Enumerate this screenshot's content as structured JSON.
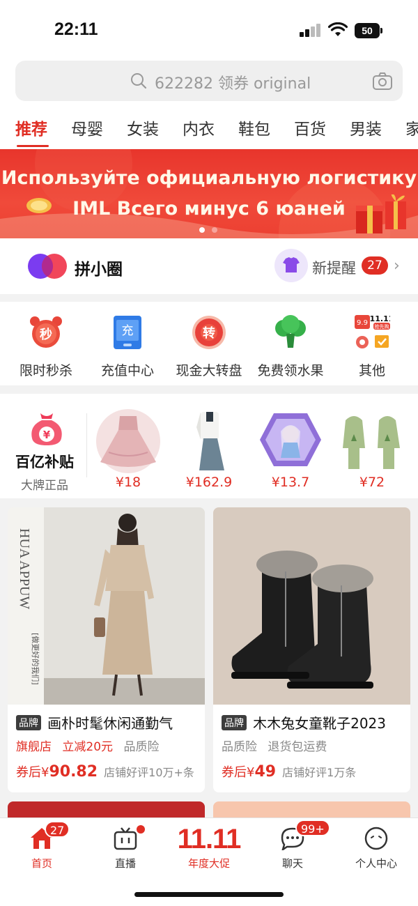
{
  "status_bar": {
    "time": "22:11",
    "battery": "50"
  },
  "search": {
    "placeholder": "622282 领券 original"
  },
  "categories": [
    "推荐",
    "母婴",
    "女装",
    "内衣",
    "鞋包",
    "百货",
    "男装",
    "家"
  ],
  "active_category": "推荐",
  "banner": {
    "line1": "Используйте официальную логистику",
    "line2": "IML Всего минус 6 юаней",
    "page_count": 2,
    "active_page": 1
  },
  "pinxiaoquan": {
    "title": "拼小圈",
    "reminder_label": "新提醒",
    "reminder_count": "27"
  },
  "quick_links": [
    {
      "label": "限时秒杀",
      "icon": "alarm-clock-icon",
      "glyph": "秒"
    },
    {
      "label": "充值中心",
      "icon": "phone-recharge-icon",
      "glyph": "充"
    },
    {
      "label": "现金大转盘",
      "icon": "spin-wheel-icon",
      "glyph": "转"
    },
    {
      "label": "免费领水果",
      "icon": "broccoli-icon",
      "glyph": ""
    },
    {
      "label": "其他",
      "icon": "more-apps-icon",
      "glyph": ""
    }
  ],
  "more_apps_icon_text": {
    "tag_99": "9.9",
    "tag_1111": "11.11",
    "tag_sub": "抢先购"
  },
  "subsidy": {
    "title": "百亿补贴",
    "subtitle": "大牌正品",
    "icon_glyph": "¥",
    "products": [
      {
        "price": "¥18",
        "icon": "pink-dress-image"
      },
      {
        "price": "¥162.9",
        "icon": "blazer-skirt-image"
      },
      {
        "price": "¥13.7",
        "icon": "frozen-toy-box-image"
      },
      {
        "price": "¥72",
        "icon": "kids-pajamas-image"
      }
    ]
  },
  "cards": [
    {
      "image": "woman-beige-dress-image",
      "image_side_text": "HUA APPUW",
      "image_side_small": "[做更好的我们]",
      "brand_tag": "品牌",
      "title": "画朴时髦休闲通勤气",
      "tags_red": [
        "旗舰店",
        "立减20元"
      ],
      "tags_gray": [
        "品质险"
      ],
      "price_prefix": "券后¥",
      "price": "90.82",
      "note": "店铺好评10万+条"
    },
    {
      "image": "black-kids-boots-image",
      "brand_tag": "品牌",
      "title": "木木兔女童靴子2023",
      "tags_red": [],
      "tags_gray": [
        "品质险",
        "退货包运费"
      ],
      "price_prefix": "券后¥",
      "price": "49",
      "note": "店铺好评1万条"
    }
  ],
  "tabbar": [
    {
      "label": "首页",
      "icon": "home-icon",
      "badge": "27",
      "active": true
    },
    {
      "label": "直播",
      "icon": "tv-live-icon",
      "dot": true
    },
    {
      "label": "年度大促",
      "icon": "promo-1111-icon",
      "big_text": "11.11"
    },
    {
      "label": "聊天",
      "icon": "chat-bubble-icon",
      "badge": "99+"
    },
    {
      "label": "个人中心",
      "icon": "profile-face-icon"
    }
  ],
  "colors": {
    "accent": "#e02e24",
    "banner_bg": "#e8352c",
    "page_bg": "#f2f2f2"
  }
}
